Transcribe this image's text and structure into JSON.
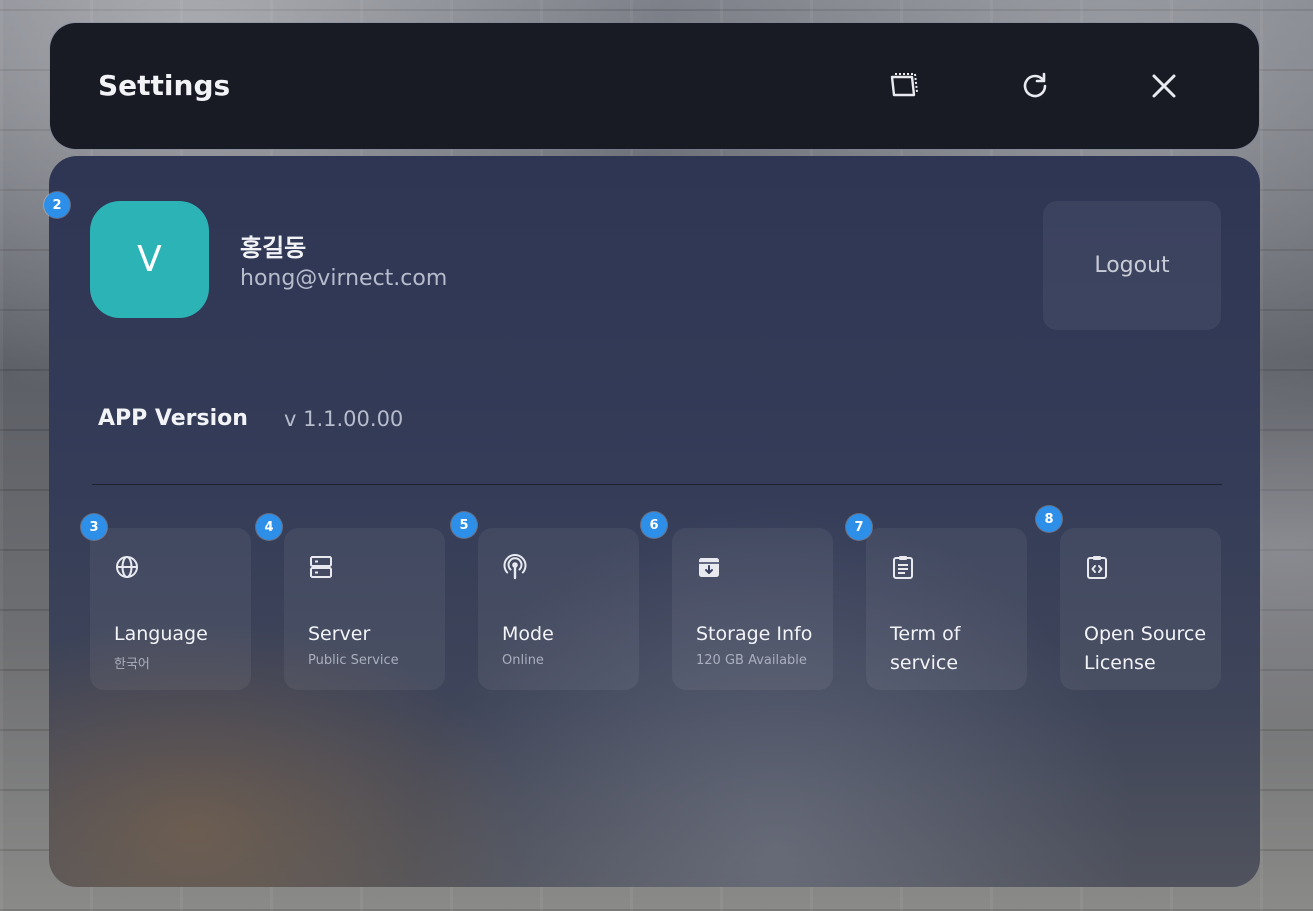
{
  "header": {
    "title": "Settings",
    "icons": [
      "window-mode-icon",
      "refresh-icon",
      "close-icon"
    ]
  },
  "profile": {
    "avatar_letter": "V",
    "avatar_color": "#2bb3b5",
    "name": "홍길동",
    "email": "hong@virnect.com",
    "logout_label": "Logout"
  },
  "version": {
    "label": "APP Version",
    "value": "v 1.1.00.00"
  },
  "cards": [
    {
      "label": "Language",
      "sub": "한국어",
      "icon": "globe-icon"
    },
    {
      "label": "Server",
      "sub": "Public Service",
      "icon": "server-icon"
    },
    {
      "label": "Mode",
      "sub": "Online",
      "icon": "broadcast-icon"
    },
    {
      "label": "Storage Info",
      "sub": "120 GB Available",
      "icon": "archive-download-icon"
    },
    {
      "label": "Term of service",
      "sub": "",
      "icon": "clipboard-list-icon"
    },
    {
      "label": "Open Source License",
      "sub": "",
      "icon": "clipboard-code-icon"
    }
  ],
  "badges": [
    "2",
    "3",
    "4",
    "5",
    "6",
    "7",
    "8"
  ],
  "colors": {
    "badge": "#2e8fe8",
    "header_bg": "#181a24",
    "panel_bg": "#343c58"
  }
}
